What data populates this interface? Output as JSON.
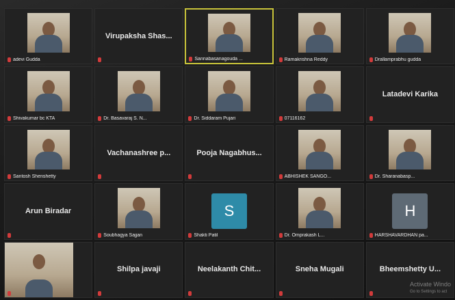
{
  "colors": {
    "active_border": "#c8c33a",
    "muted_mic": "#d23b3b",
    "avatar_s": "#2e8ba8",
    "avatar_h": "#5e6a75"
  },
  "tiles": [
    {
      "label": "adevi Gudda",
      "video": true
    },
    {
      "center": "Virupaksha Shas..."
    },
    {
      "label": "Sannabasanagouda ...",
      "video": true,
      "active": true
    },
    {
      "label": "Ramakrishna Reddy",
      "video": true
    },
    {
      "label": "Drallamprabhu gudda",
      "video": true
    },
    {
      "label": "Shivakumar bc KTA",
      "video": true
    },
    {
      "label": "Dr. Basavaraj S. N...",
      "video": true
    },
    {
      "label": "Dr. Siddaram Pujari",
      "video": true
    },
    {
      "label": "07116162",
      "video": true
    },
    {
      "center": "Latadevi Karika"
    },
    {
      "label": "Santosh Shenshetty",
      "video": true
    },
    {
      "center": "Vachanashree p..."
    },
    {
      "center": "Pooja Nagabhus..."
    },
    {
      "label": "ABHISHEK SANGO...",
      "video": true
    },
    {
      "label": "Dr. Sharanabasp...",
      "video": true
    },
    {
      "center": "Arun Biradar"
    },
    {
      "label": "Soubhagya Sajjan",
      "video": true
    },
    {
      "label": "Shakti Patil",
      "avatar": "S"
    },
    {
      "label": "Dr. Omprakash L...",
      "video": true
    },
    {
      "label": "HARSHAVARDHAN pa...",
      "avatar": "H"
    },
    {
      "label": "",
      "video": true,
      "wide": true
    },
    {
      "center": "Shilpa javaji"
    },
    {
      "center": "Neelakanth Chit..."
    },
    {
      "center": "Sneha Mugali"
    },
    {
      "center": "Bheemshetty U..."
    }
  ],
  "watermark": {
    "line1": "Activate Windo",
    "line2": "Go to Settings to act"
  }
}
